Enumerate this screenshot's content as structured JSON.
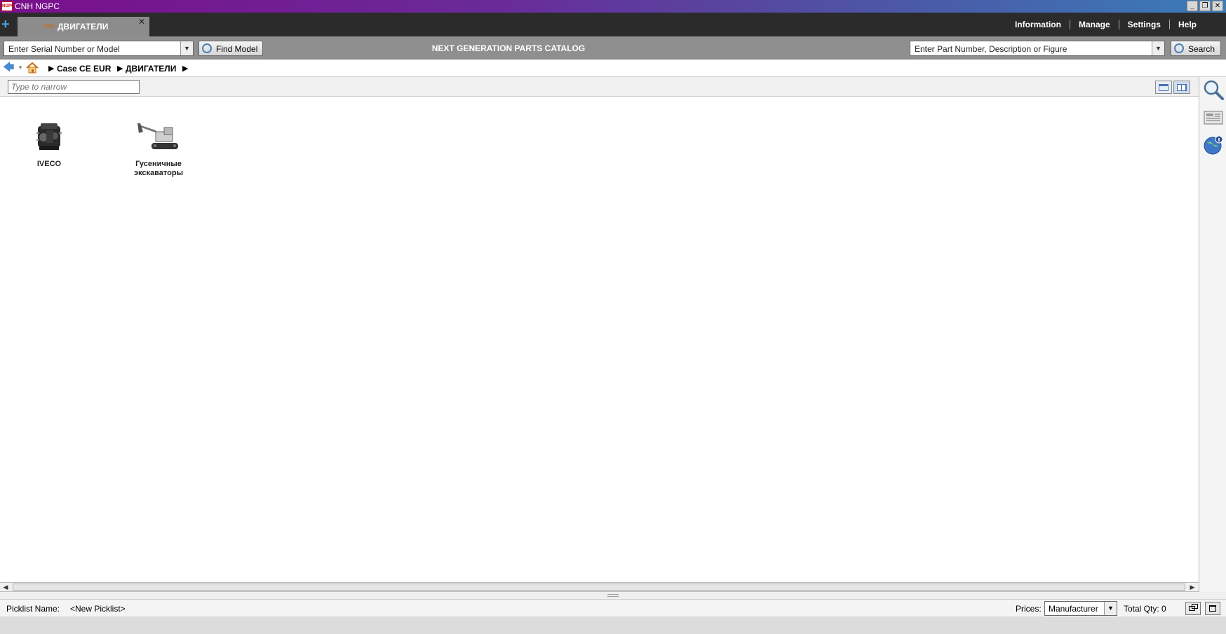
{
  "window": {
    "title": "CNH NGPC",
    "app_icon_text": "NGPC",
    "controls": {
      "minimize": "_",
      "restore": "❐",
      "close": "✕"
    }
  },
  "tabs": [
    {
      "label": "ДВИГАТЕЛИ",
      "close": "✕"
    }
  ],
  "new_tab_symbol": "+",
  "top_menu": {
    "information": "Information",
    "manage": "Manage",
    "settings": "Settings",
    "help": "Help"
  },
  "toolbar": {
    "serial_placeholder": "Enter Serial Number or Model",
    "find_model_label": "Find Model",
    "catalog_title": "NEXT GENERATION PARTS CATALOG",
    "part_placeholder": "Enter Part Number, Description or Figure",
    "search_label": "Search",
    "dropdown_arrow": "▼"
  },
  "breadcrumb": {
    "back_symbol": "🡄",
    "drop_symbol": "▼",
    "items": [
      "Case CE EUR",
      "ДВИГАТЕЛИ"
    ],
    "separator": "▶"
  },
  "filter": {
    "placeholder": "Type to narrow"
  },
  "tiles": [
    {
      "label": "IVECO",
      "icon": "engine-icon"
    },
    {
      "label_line1": "Гусеничные",
      "label_line2": "экскаваторы",
      "icon": "excavator-icon"
    }
  ],
  "side_panel": {
    "icons": [
      "search-icon",
      "news-icon",
      "globe-info-icon"
    ]
  },
  "scrollbar": {
    "left": "◀",
    "right": "▶"
  },
  "status": {
    "picklist_label": "Picklist Name:",
    "picklist_value": "<New Picklist>",
    "prices_label": "Prices:",
    "prices_value": "Manufacturer",
    "total_qty": "Total Qty: 0"
  },
  "colors": {
    "title_gradient_start": "#7a0f8c",
    "title_gradient_end": "#3a7cb8",
    "tabbar": "#2b2b2b",
    "toolbar": "#8f8f8f",
    "accent": "#4a8ad0"
  }
}
